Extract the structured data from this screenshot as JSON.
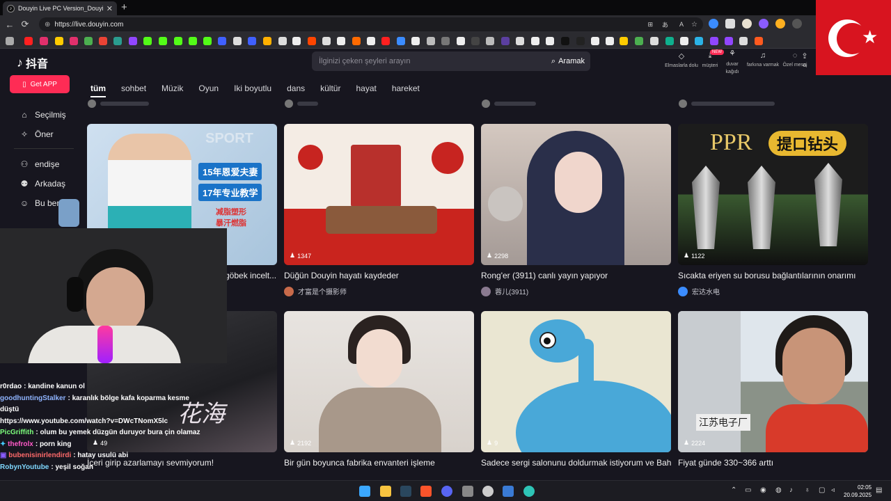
{
  "browser": {
    "tab_title": "Douyin Live PC Version_Douyin L",
    "url": "https://live.douyin.com"
  },
  "header": {
    "logo_text": "抖音",
    "get_app": "Get APP",
    "search_placeholder": "İlginizi çeken şeyleri arayın",
    "search_button": "Aramak",
    "new_badge": "NEW",
    "top_icons": [
      {
        "label": "Elmaslarla dolu",
        "icon": "diamond-icon"
      },
      {
        "label": "müşteri",
        "icon": "download-icon"
      },
      {
        "label": "duvar kağıdı",
        "icon": "wallpaper-icon"
      },
      {
        "label": "farkına varmak",
        "icon": "bell-icon"
      },
      {
        "label": "Özel mesaj",
        "icon": "message-icon"
      },
      {
        "label": "G",
        "icon": "contribute-icon"
      }
    ]
  },
  "sidebar": {
    "items": [
      {
        "label": "Seçilmiş",
        "icon": "home-icon"
      },
      {
        "label": "Öner",
        "icon": "star-icon"
      },
      {
        "label": "endişe",
        "icon": "follow-icon"
      },
      {
        "label": "Arkadaş",
        "icon": "friends-icon"
      },
      {
        "label": "Bu ben",
        "icon": "user-icon"
      }
    ]
  },
  "categories": [
    "tüm",
    "sohbet",
    "Müzik",
    "Oyun",
    "Iki boyutlu",
    "dans",
    "kültür",
    "hayat",
    "hareket"
  ],
  "cards": [
    {
      "viewers": "",
      "title": "göbek incelt...",
      "author": ""
    },
    {
      "viewers": "1347",
      "title": "Düğün Douyin hayatı kaydeder",
      "author": "才富是个摄影师"
    },
    {
      "viewers": "2298",
      "title": "Rong'er (3911) canlı yayın yapıyor",
      "author": "蓉儿(3911)"
    },
    {
      "viewers": "1122",
      "title": "Sıcakta eriyen su borusu bağlantılarının onarımı",
      "author": "宏达水电"
    },
    {
      "viewers": "49",
      "title": "İçeri girip azarlamayı sevmiyorum!",
      "author": ""
    },
    {
      "viewers": "2192",
      "title": "Bir gün boyunca fabrika envanteri işleme",
      "author": ""
    },
    {
      "viewers": "9",
      "title": "Sadece sergi salonunu doldurmak istiyorum ve Bah...",
      "author": ""
    },
    {
      "viewers": "2224",
      "title": "Fiyat günde 330~366 arttı",
      "author": ""
    }
  ],
  "thumb_text": {
    "c0_a": "15年恩爱夫妻",
    "c0_b": "17年专业教学",
    "c0_c": "减脂塑形",
    "c0_d": "暴汗燃脂",
    "c0_sport": "SPORT",
    "c3_ppr": "PPR",
    "c3_cn": "提口钻头",
    "c4_cn": "花海",
    "c7_cn": "江苏电子厂"
  },
  "chat": [
    {
      "user": "r0rdao",
      "msg": "kandine kanun ol",
      "color": "#ffffff"
    },
    {
      "user": "goodhuntingStalker",
      "msg": "karanlık bölge kafa koparma kesme düştü",
      "color": "#8fb4ff"
    },
    {
      "user": "",
      "msg": "https://www.youtube.com/watch?v=DWcTNomX5lc",
      "color": "#ffffff"
    },
    {
      "user": "PicGriffith",
      "msg": "olum bu yemek düzgün duruyor bura çin olamaz",
      "color": "#7cff7c"
    },
    {
      "user": "thefrolx",
      "msg": "porn king",
      "color": "#ff5ac8"
    },
    {
      "user": "bubenisinirlendirdi",
      "msg": "hatay usulü abi",
      "color": "#ff6a6a"
    },
    {
      "user": "RobynYoutube",
      "msg": "yeşil soğan",
      "color": "#7fd8ff"
    }
  ],
  "taskbar": {
    "time": "02:05",
    "date": "20.09.2025"
  },
  "colors": {
    "accent": "#fe2c55",
    "background": "#17161f",
    "flag": "#d8141f"
  }
}
